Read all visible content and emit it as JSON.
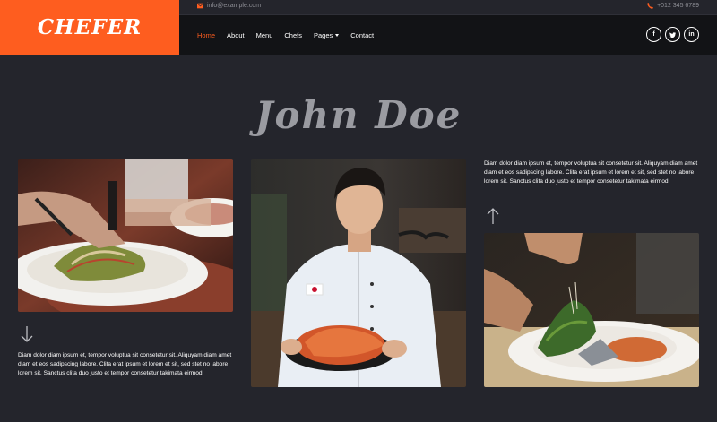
{
  "brand": {
    "logo": "CHEFER",
    "accent": "#fe5d1f"
  },
  "topbar": {
    "email": "info@example.com",
    "phone": "+012 345 6789"
  },
  "nav": {
    "items": [
      {
        "label": "Home",
        "active": true
      },
      {
        "label": "About"
      },
      {
        "label": "Menu"
      },
      {
        "label": "Chefs"
      },
      {
        "label": "Pages",
        "dropdown": true
      },
      {
        "label": "Contact"
      }
    ],
    "socials": [
      {
        "icon": "facebook-icon",
        "glyph": "f"
      },
      {
        "icon": "twitter-icon",
        "glyph": "t"
      },
      {
        "icon": "linkedin-icon",
        "glyph": "in"
      }
    ]
  },
  "chef": {
    "name": "John Doe",
    "description_left": "Diam dolor diam ipsum et, tempor voluptua sit consetetur sit. Aliquyam diam amet diam et eos sadipscing labore. Clita erat ipsum et lorem et sit, sed stet no labore lorem sit. Sanctus clita duo justo et tempor consetetur takimata eirmod.",
    "description_right": "Diam dolor diam ipsum et, tempor voluptua sit consetetur sit. Aliquyam diam amet diam et eos sadipscing labore. Clita erat ipsum et lorem et sit, sed stet no labore lorem sit. Sanctus clita duo justo et tempor consetetur takimata eirmod."
  }
}
